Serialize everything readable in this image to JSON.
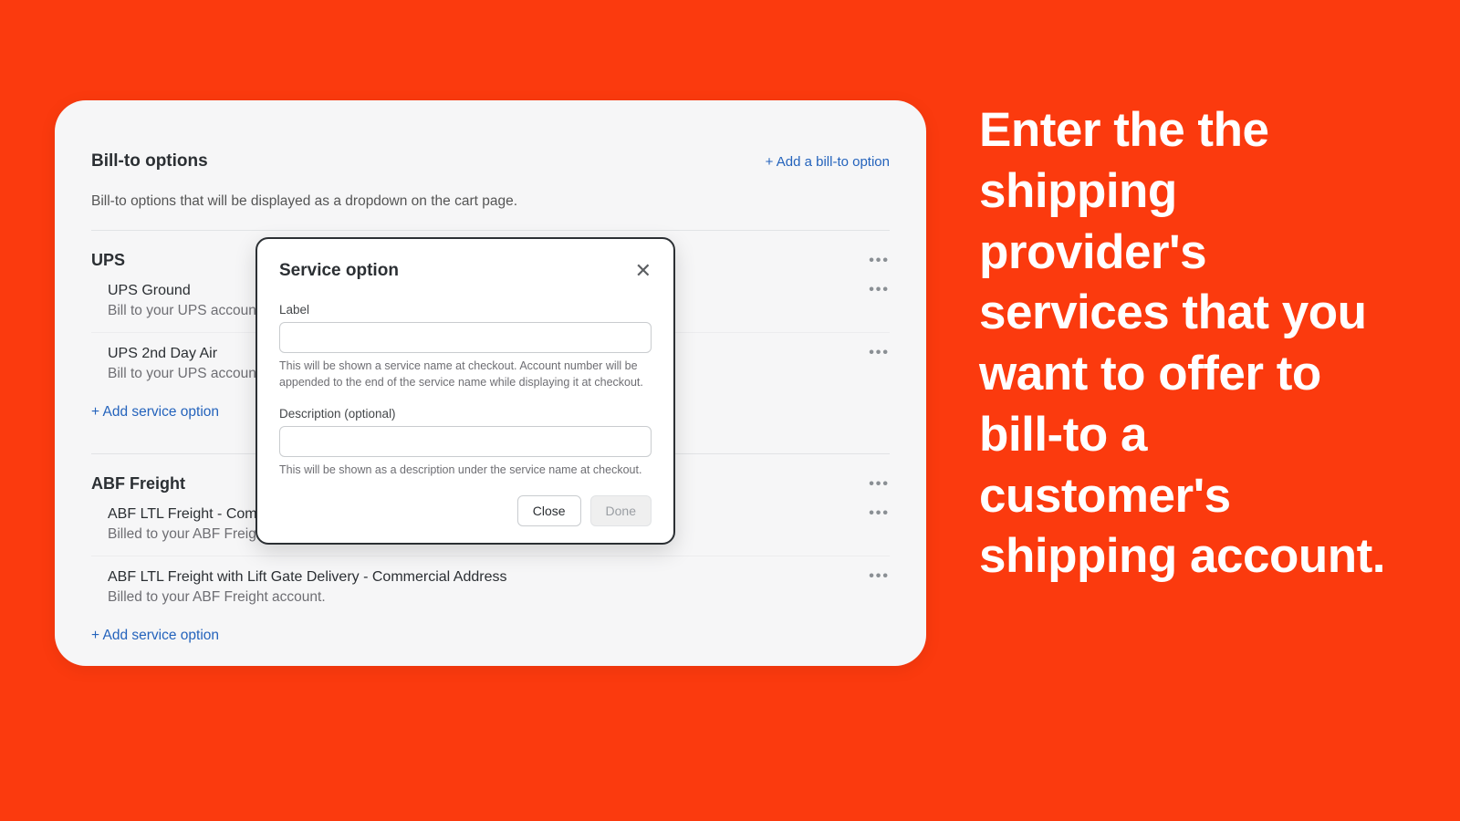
{
  "colors": {
    "bg": "#fb3a0e",
    "link": "#2463bc"
  },
  "header": {
    "title": "Bill-to options",
    "add_label": "+ Add a bill-to option",
    "subtitle": "Bill-to options that will be displayed as a dropdown on the cart page."
  },
  "groups": [
    {
      "name": "UPS",
      "options": [
        {
          "title": "UPS Ground",
          "sub": "Bill to your UPS account"
        },
        {
          "title": "UPS 2nd Day Air",
          "sub": "Bill to your UPS account"
        }
      ],
      "add_label": "+ Add service option"
    },
    {
      "name": "ABF Freight",
      "options": [
        {
          "title": "ABF LTL Freight - Commerical",
          "sub": "Billed to your ABF Freight acc"
        },
        {
          "title": "ABF LTL Freight with Lift Gate Delivery - Commercial Address",
          "sub": "Billed to your ABF Freight account."
        }
      ],
      "add_label": "+ Add service option"
    }
  ],
  "modal": {
    "title": "Service option",
    "label_field": {
      "label": "Label",
      "help": "This will be shown a service name at checkout. Account number will be appended to the end of the service name while displaying it at checkout."
    },
    "desc_field": {
      "label": "Description (optional)",
      "help": "This will be shown as a description under the service name at checkout."
    },
    "close_btn": "Close",
    "done_btn": "Done"
  },
  "promo": "Enter the the shipping provider's services that you want to offer to bill-to a customer's shipping account.",
  "glyphs": {
    "dots": "•••",
    "close": "✕"
  }
}
